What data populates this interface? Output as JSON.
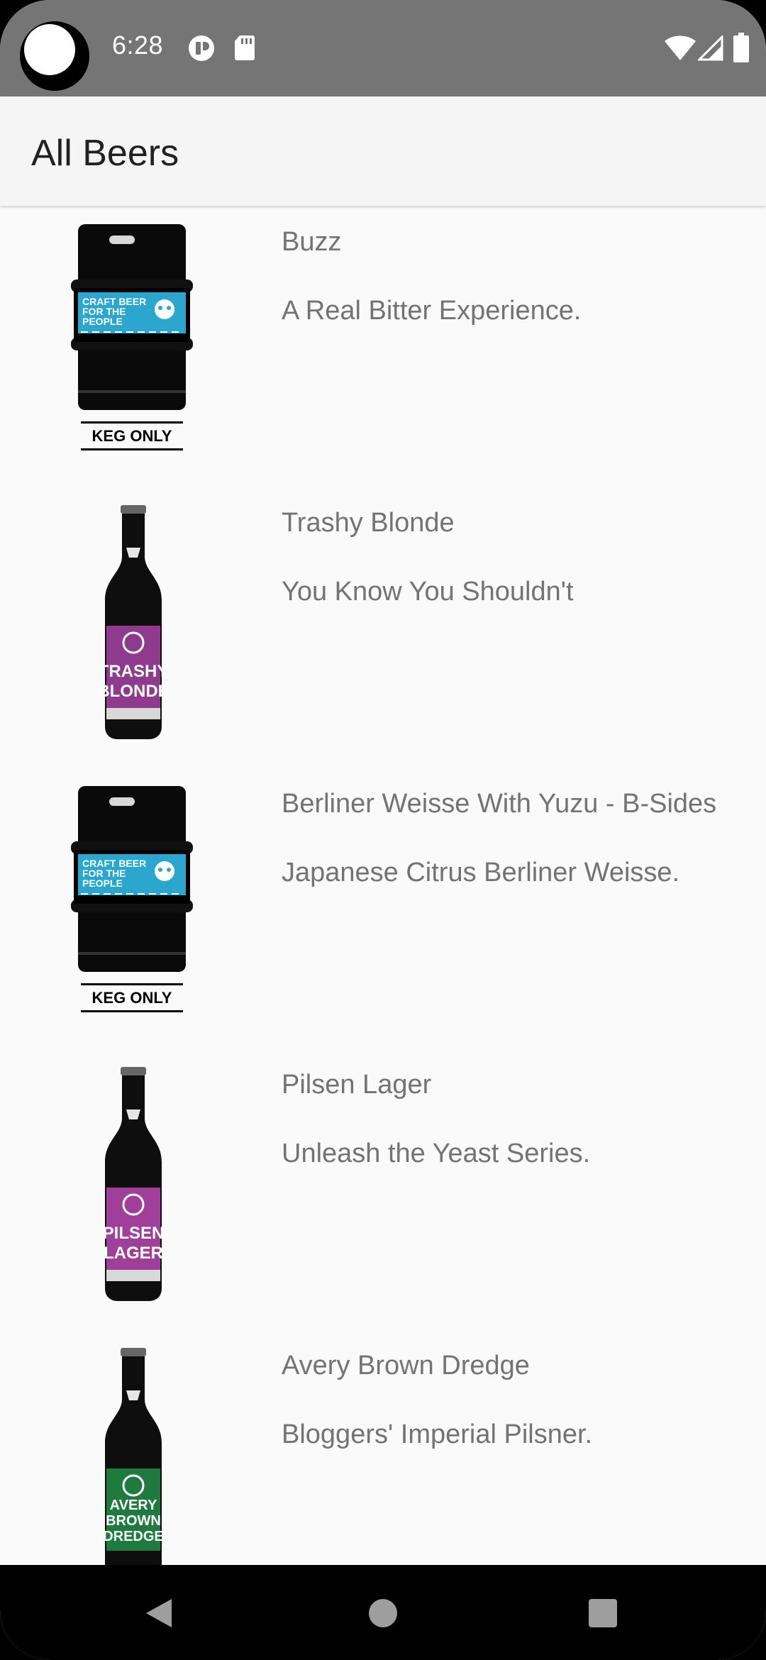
{
  "status_bar": {
    "time": "6:28",
    "icons_left": [
      "camera-cutout",
      "data-saver-icon",
      "sd-card-icon"
    ],
    "icons_right": [
      "wifi-icon",
      "cell-signal-icon",
      "battery-icon"
    ]
  },
  "app_bar": {
    "title": "All Beers"
  },
  "beers": [
    {
      "name": "Buzz",
      "tagline": "A Real Bitter Experience.",
      "image": "keg-image",
      "label_color": "#2aa6cf",
      "label_text": "KEG ONLY"
    },
    {
      "name": "Trashy Blonde",
      "tagline": "You Know You Shouldn't",
      "image": "bottle-image",
      "label_color": "#8e3b8e"
    },
    {
      "name": "Berliner Weisse With Yuzu - B-Sides",
      "tagline": "Japanese Citrus Berliner Weisse.",
      "image": "keg-image",
      "label_color": "#2aa6cf",
      "label_text": "KEG ONLY"
    },
    {
      "name": "Pilsen Lager",
      "tagline": "Unleash the Yeast Series.",
      "image": "bottle-image",
      "label_color": "#a03f9a"
    },
    {
      "name": "Avery Brown Dredge",
      "tagline": "Bloggers' Imperial Pilsner.",
      "image": "bottle-image",
      "label_color": "#1f7a3d"
    }
  ],
  "nav_bar": {
    "buttons": [
      "back-icon",
      "home-icon",
      "recents-icon"
    ]
  }
}
